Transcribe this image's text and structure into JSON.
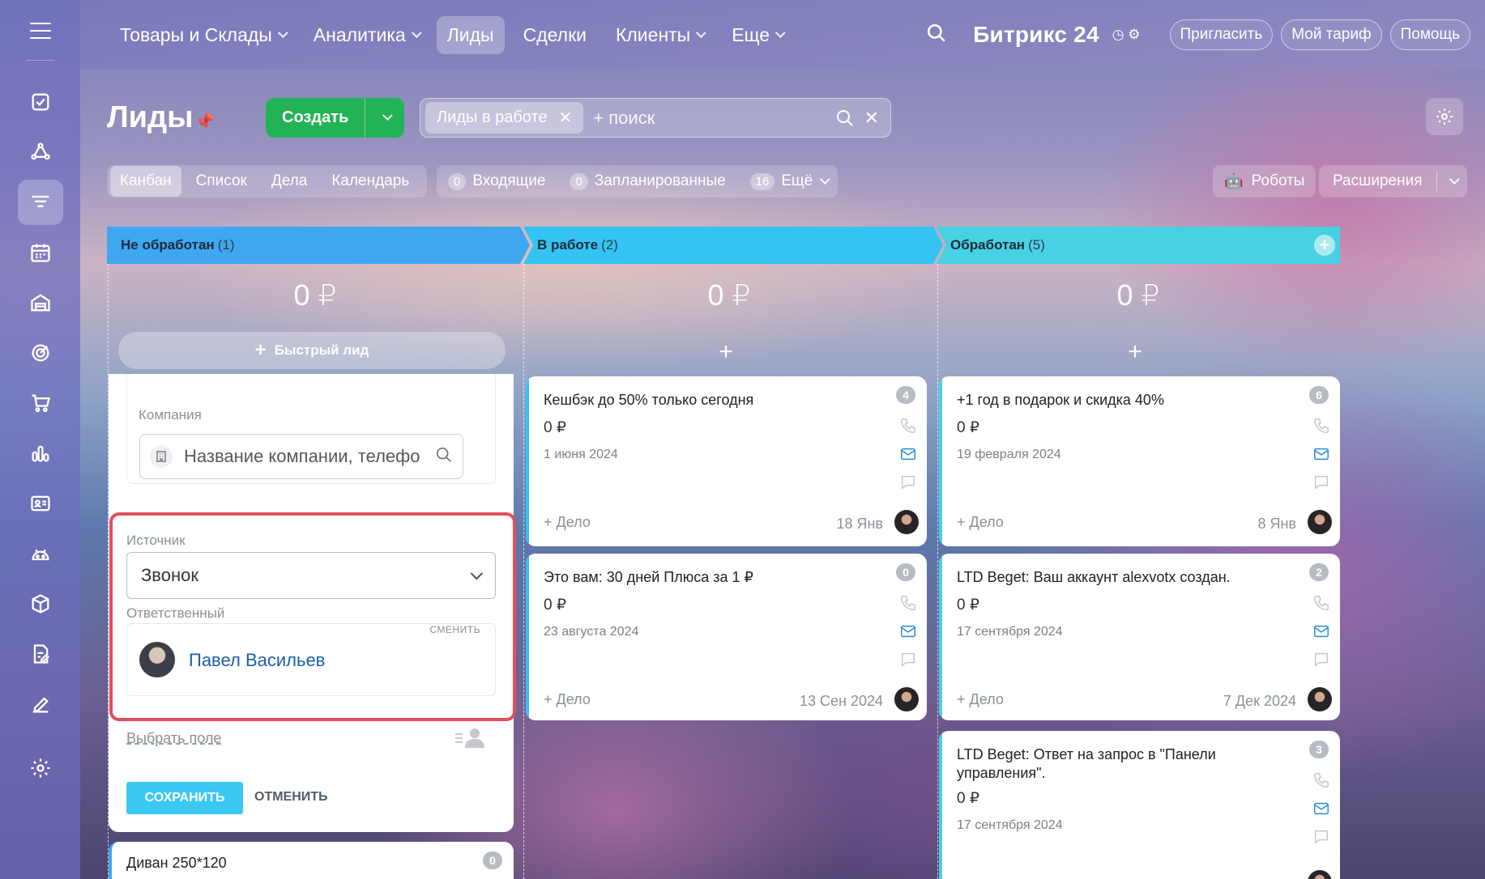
{
  "topnav": {
    "items": [
      {
        "label": "Товары и Склады",
        "has_arrow": true
      },
      {
        "label": "Аналитика",
        "has_arrow": true
      },
      {
        "label": "Лиды",
        "has_arrow": false,
        "active": true
      },
      {
        "label": "Сделки",
        "has_arrow": false
      },
      {
        "label": "Клиенты",
        "has_arrow": true
      },
      {
        "label": "Еще",
        "has_arrow": true
      }
    ],
    "brand": "Битрикс 24",
    "invite": "Пригласить",
    "tariff": "Мой тариф",
    "help": "Помощь"
  },
  "sidebar": {
    "icons": [
      "tasks-icon",
      "feed-icon",
      "crm-funnel-icon",
      "calendar-icon",
      "inventory-icon",
      "analytics-icon",
      "shop-icon",
      "chart-icon",
      "contacts-icon",
      "robot-icon",
      "box-icon",
      "docs-icon",
      "sign-icon",
      "settings-icon"
    ]
  },
  "header": {
    "title": "Лиды",
    "create_label": "Создать",
    "filter_chip": "Лиды в работе",
    "search_placeholder": "+ поиск"
  },
  "views": [
    "Канбан",
    "Список",
    "Дела",
    "Календарь"
  ],
  "counters": [
    {
      "count": "0",
      "label": "Входящие"
    },
    {
      "count": "0",
      "label": "Запланированные"
    },
    {
      "count": "16",
      "label": "Ещё"
    }
  ],
  "robots": "Роботы",
  "extensions": "Расширения",
  "columns": [
    {
      "title": "Не обработан",
      "count": "(1)",
      "sum": "0 ₽",
      "color": "#3ea7f0"
    },
    {
      "title": "В работе",
      "count": "(2)",
      "sum": "0 ₽",
      "color": "#33c4f3"
    },
    {
      "title": "Обработан",
      "count": "(5)",
      "sum": "0 ₽",
      "color": "#47d1e2"
    }
  ],
  "quick_lead": "Быстрый лид",
  "form": {
    "company_label": "Компания",
    "company_placeholder": "Название компании, телефо",
    "source_label": "Источник",
    "source_value": "Звонок",
    "responsible_label": "Ответственный",
    "change_link": "СМЕНИТЬ",
    "responsible_name": "Павел Васильев",
    "choose_field": "Выбрать поле",
    "save": "СОХРАНИТЬ",
    "cancel": "ОТМЕНИТЬ"
  },
  "divan": {
    "title": "Диван 250*120",
    "badge": "0"
  },
  "cards_col2": [
    {
      "title": "Кешбэк до 50% только сегодня",
      "sum": "0 ₽",
      "date": "1 июня 2024",
      "deal": "+ Дело",
      "deal_date": "18 Янв",
      "badge": "4"
    },
    {
      "title": "Это вам: 30 дней Плюса за 1 ₽",
      "sum": "0 ₽",
      "date": "23 августа 2024",
      "deal": "+ Дело",
      "deal_date": "13 Сен 2024",
      "badge": "0"
    }
  ],
  "cards_col3": [
    {
      "title": "+1 год в подарок и скидка 40%",
      "sum": "0 ₽",
      "date": "19 февраля 2024",
      "deal": "+ Дело",
      "deal_date": "8 Янв",
      "badge": "6"
    },
    {
      "title": "LTD Beget: Ваш аккаунт alexvotx создан.",
      "sum": "0 ₽",
      "date": "17 сентября 2024",
      "deal": "+ Дело",
      "deal_date": "7 Дек 2024",
      "badge": "2"
    },
    {
      "title": "LTD Beget: Ответ на запрос в \"Панели управления\".",
      "sum": "0 ₽",
      "date": "17 сентября 2024",
      "badge": "3"
    }
  ]
}
